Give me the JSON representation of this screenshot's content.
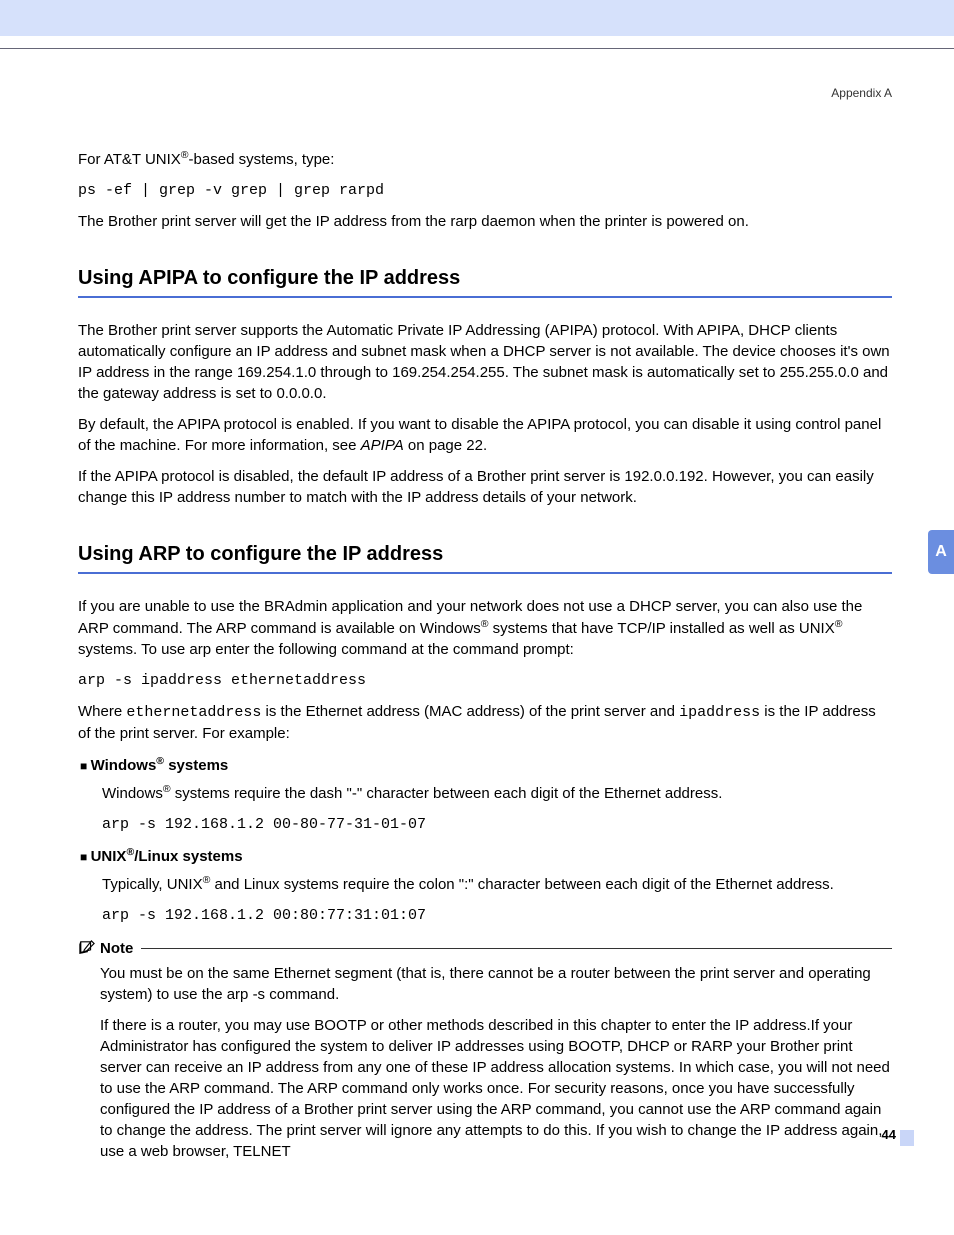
{
  "header": {
    "appendix": "Appendix A"
  },
  "side_tab": "A",
  "page_number": "44",
  "intro": {
    "line1_a": "For AT&T UNIX",
    "line1_b": "-based systems, type:",
    "cmd": "ps -ef | grep -v grep | grep rarpd",
    "line2": "The Brother print server will get the IP address from the rarp daemon when the printer is powered on."
  },
  "apipa": {
    "heading": "Using APIPA to configure the IP address",
    "p1": "The Brother print server supports the Automatic Private IP Addressing (APIPA) protocol. With APIPA, DHCP clients automatically configure an IP address and subnet mask when a DHCP server is not available. The device chooses it's own IP address in the range 169.254.1.0 through to 169.254.254.255. The subnet mask is automatically set to 255.255.0.0 and the gateway address is set to 0.0.0.0.",
    "p2_a": "By default, the APIPA protocol is enabled. If you want to disable the APIPA protocol, you can disable it using control panel of the machine. For more information, see ",
    "p2_ref": "APIPA",
    "p2_b": " on page 22.",
    "p3": "If the APIPA protocol is disabled, the default IP address of a Brother print server is 192.0.0.192. However, you can easily change this IP address number to match with the IP address details of your network."
  },
  "arp": {
    "heading": "Using ARP to configure the IP address",
    "p1_a": "If you are unable to use the BRAdmin application and your network does not use a DHCP server, you can also use the ARP command. The ARP command is available on Windows",
    "p1_b": " systems that have TCP/IP installed as well as UNIX",
    "p1_c": " systems. To use arp enter the following command at the command prompt:",
    "cmd1": "arp -s ipaddress ethernetaddress",
    "p2_a": "Where ",
    "p2_eth": "ethernetaddress",
    "p2_b": " is the Ethernet address (MAC address) of the print server and ",
    "p2_ip": "ipaddress",
    "p2_c": " is the IP address of the print server. For example:",
    "win": {
      "heading_a": "Windows",
      "heading_b": " systems",
      "body_a": "Windows",
      "body_b": " systems require the dash \"-\" character between each digit of the Ethernet address.",
      "cmd": "arp -s 192.168.1.2 00-80-77-31-01-07"
    },
    "unix": {
      "heading_a": "UNIX",
      "heading_b": "/Linux systems",
      "body_a": "Typically, UNIX",
      "body_b": " and Linux systems require the colon \":\" character between each digit of the Ethernet address.",
      "cmd": "arp -s 192.168.1.2 00:80:77:31:01:07"
    },
    "note": {
      "label": "Note",
      "p1": "You must be on the same Ethernet segment (that is, there cannot be a router between the print server and operating system) to use the arp -s command.",
      "p2": "If there is a router, you may use BOOTP or other methods described in this chapter to enter the IP address.If your Administrator has configured the system to deliver IP addresses using BOOTP, DHCP or RARP your Brother print server can receive an IP address from any one of these IP address allocation systems. In which case, you will not need to use the ARP command. The ARP command only works once. For security reasons, once you have successfully configured the IP address of a Brother print server using the ARP command, you cannot use the ARP command again to change the address. The print server will ignore any attempts to do this. If you wish to change the IP address again, use a web browser, TELNET"
    }
  }
}
